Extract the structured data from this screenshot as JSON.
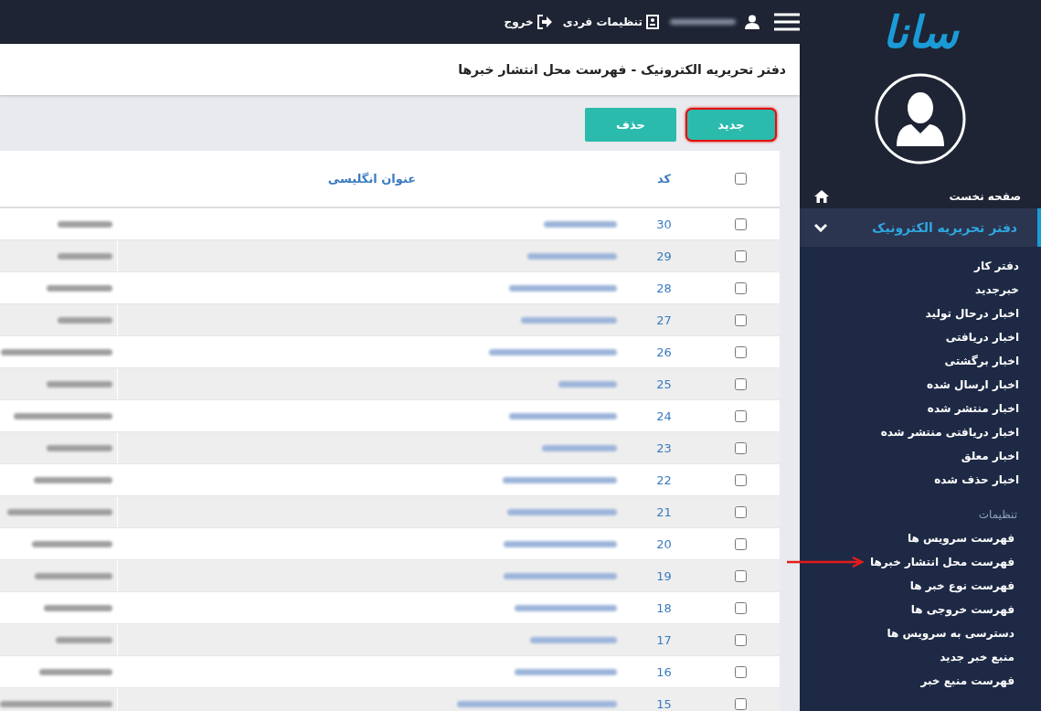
{
  "sidebar": {
    "logo": "سانا",
    "home": {
      "label": "صفحه نخست"
    },
    "section": {
      "label": "دفتر تحریریه الکترونیک",
      "expanded": true,
      "items": [
        {
          "label": "دفتر کار",
          "marked": false
        },
        {
          "label": "خبرجدید",
          "marked": false
        },
        {
          "label": "اخبار درحال تولید",
          "marked": false
        },
        {
          "label": "اخبار دریافتی",
          "marked": false
        },
        {
          "label": "اخبار برگشتی",
          "marked": false
        },
        {
          "label": "اخبار ارسال شده",
          "marked": false
        },
        {
          "label": "اخبار منتشر شده",
          "marked": false
        },
        {
          "label": "اخبار دریافتی منتشر شده",
          "marked": false
        },
        {
          "label": "اخبار معلق",
          "marked": false
        },
        {
          "label": "اخبار حذف شده",
          "marked": false
        }
      ]
    },
    "settings": {
      "heading": "تنظیمات",
      "items": [
        {
          "label": "فهرست سرویس ها",
          "marked": false
        },
        {
          "label": "فهرست محل انتشار خبرها",
          "marked": true
        },
        {
          "label": "فهرست نوع خبر ها",
          "marked": false
        },
        {
          "label": "فهرست خروجی ها",
          "marked": false
        },
        {
          "label": "دسترسی به سرویس ها",
          "marked": false
        },
        {
          "label": "منبع خبر جدید",
          "marked": false
        },
        {
          "label": "فهرست منبع خبر",
          "marked": false
        }
      ]
    }
  },
  "topbar": {
    "settings": "تنظیمات فردی",
    "logout": "خروج"
  },
  "page_title": "دفتر تحریریه الکترونیک - فهرست محل انتشار خبرها",
  "buttons": [
    {
      "label": "جدید",
      "highlighted": true
    },
    {
      "label": "حذف",
      "highlighted": false
    }
  ],
  "table": {
    "select_all": {
      "checked": false
    },
    "columns": [
      "کد",
      "عنوان انگلیسی"
    ],
    "rows": [
      {
        "code": "30",
        "checked": false
      },
      {
        "code": "29",
        "checked": false
      },
      {
        "code": "28",
        "checked": false
      },
      {
        "code": "27",
        "checked": false
      },
      {
        "code": "26",
        "checked": false
      },
      {
        "code": "25",
        "checked": false
      },
      {
        "code": "24",
        "checked": false
      },
      {
        "code": "23",
        "checked": false
      },
      {
        "code": "22",
        "checked": false
      },
      {
        "code": "21",
        "checked": false
      },
      {
        "code": "20",
        "checked": false
      },
      {
        "code": "19",
        "checked": false
      },
      {
        "code": "18",
        "checked": false
      },
      {
        "code": "17",
        "checked": false
      },
      {
        "code": "16",
        "checked": false
      },
      {
        "code": "15",
        "checked": false
      }
    ]
  }
}
